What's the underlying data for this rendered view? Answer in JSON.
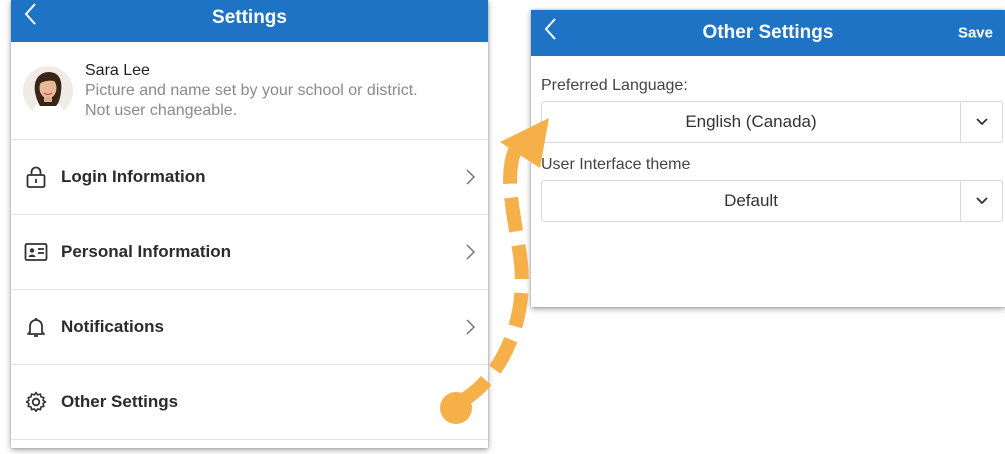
{
  "left_panel": {
    "header": {
      "title": "Settings",
      "back_icon": "chevron-left-icon"
    },
    "profile": {
      "name": "Sara Lee",
      "subtitle_line1": "Picture and name set by your school or district.",
      "subtitle_line2": "Not user changeable."
    },
    "menu": [
      {
        "label": "Login Information",
        "icon": "lock-icon"
      },
      {
        "label": "Personal Information",
        "icon": "id-card-icon"
      },
      {
        "label": "Notifications",
        "icon": "bell-icon"
      },
      {
        "label": "Other Settings",
        "icon": "gear-icon"
      }
    ]
  },
  "right_panel": {
    "header": {
      "title": "Other Settings",
      "save_label": "Save",
      "back_icon": "chevron-left-icon"
    },
    "fields": [
      {
        "label": "Preferred Language:",
        "value": "English (Canada)"
      },
      {
        "label": "User Interface theme",
        "value": "Default"
      }
    ]
  },
  "colors": {
    "header_blue": "#1f73c4",
    "arrow_orange": "#f5b04a"
  }
}
